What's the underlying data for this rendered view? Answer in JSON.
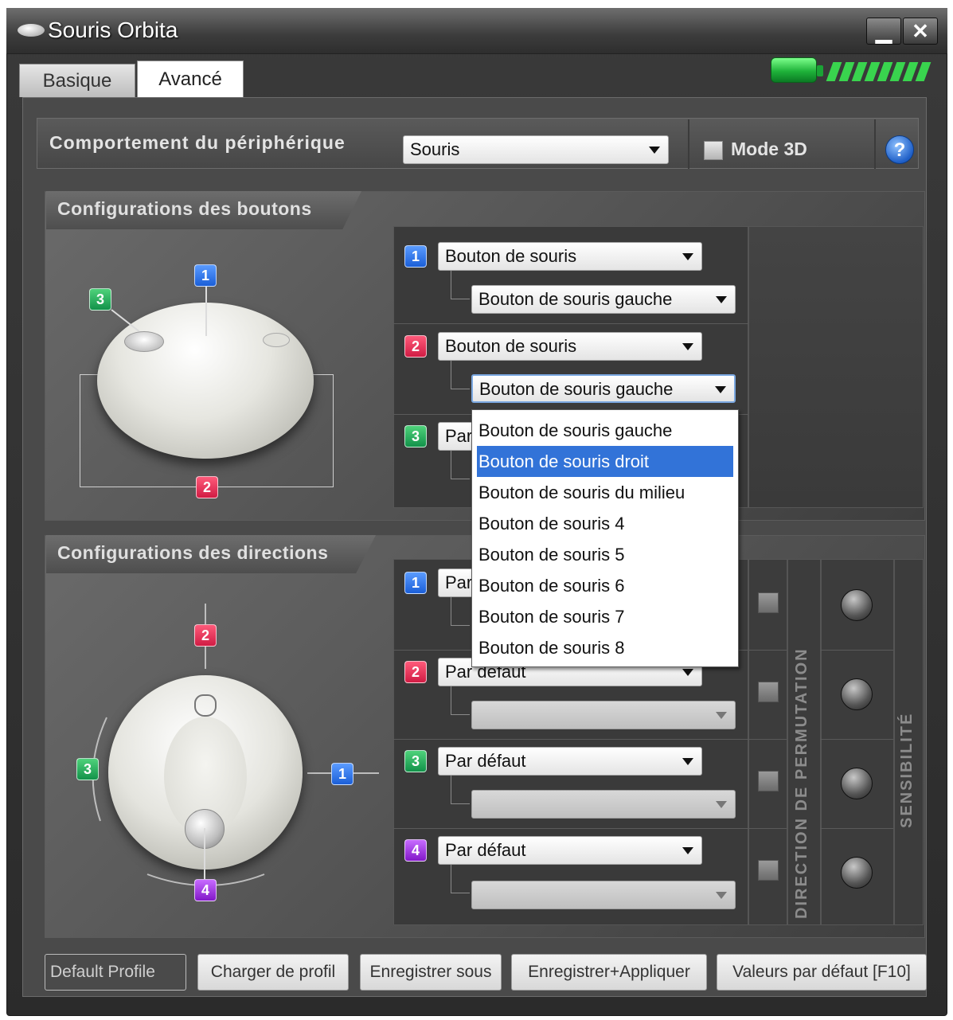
{
  "window": {
    "title": "Souris Orbita",
    "minimize_label": "▁",
    "close_label": "✕"
  },
  "tabs": [
    {
      "label": "Basique",
      "active": false
    },
    {
      "label": "Avancé",
      "active": true
    }
  ],
  "battery": {
    "icon": "battery-icon",
    "color": "#2bc845",
    "level": 1.0
  },
  "behavior": {
    "label": "Comportement du périphérique",
    "value": "Souris",
    "mode3d_label": "Mode 3D",
    "mode3d_checked": false,
    "help_label": "?"
  },
  "buttons_section": {
    "title": "Configurations des boutons",
    "image_labels": [
      "1",
      "2",
      "3"
    ],
    "rows": [
      {
        "badge": "1",
        "color": "#2a6ee8",
        "action": "Bouton de souris",
        "sub": "Bouton de souris gauche"
      },
      {
        "badge": "2",
        "color": "#e2264f",
        "action": "Bouton de souris",
        "sub": "Bouton de souris gauche"
      },
      {
        "badge": "3",
        "color": "#1ea558",
        "action": "Par défaut",
        "sub": ""
      }
    ]
  },
  "dropdown": {
    "options": [
      "Bouton de souris gauche",
      "Bouton de souris droit",
      "Bouton de souris du milieu",
      "Bouton de souris 4",
      "Bouton de souris 5",
      "Bouton de souris 6",
      "Bouton de souris 7",
      "Bouton de souris 8"
    ],
    "highlighted_index": 1,
    "highlight_color": "#3273d8"
  },
  "directions_section": {
    "title": "Configurations des directions",
    "image_labels": [
      "1",
      "2",
      "3",
      "4"
    ],
    "rows": [
      {
        "badge": "1",
        "color": "#2a6ee8",
        "action": "Par défaut",
        "sub": ""
      },
      {
        "badge": "2",
        "color": "#e2264f",
        "action": "Par défaut",
        "sub": ""
      },
      {
        "badge": "3",
        "color": "#1ea558",
        "action": "Par défaut",
        "sub": ""
      },
      {
        "badge": "4",
        "color": "#9a2be0",
        "action": "Par défaut",
        "sub": ""
      }
    ],
    "permutation_label": "DIRECTION DE PERMUTATION",
    "sensitivity_label": "SENSIBILITÉ"
  },
  "footer": {
    "profile_name": "Default Profile",
    "load_label": "Charger de profil",
    "save_as_label": "Enregistrer sous",
    "save_apply_label": "Enregistrer+Appliquer",
    "defaults_label": "Valeurs par défaut [F10]"
  }
}
